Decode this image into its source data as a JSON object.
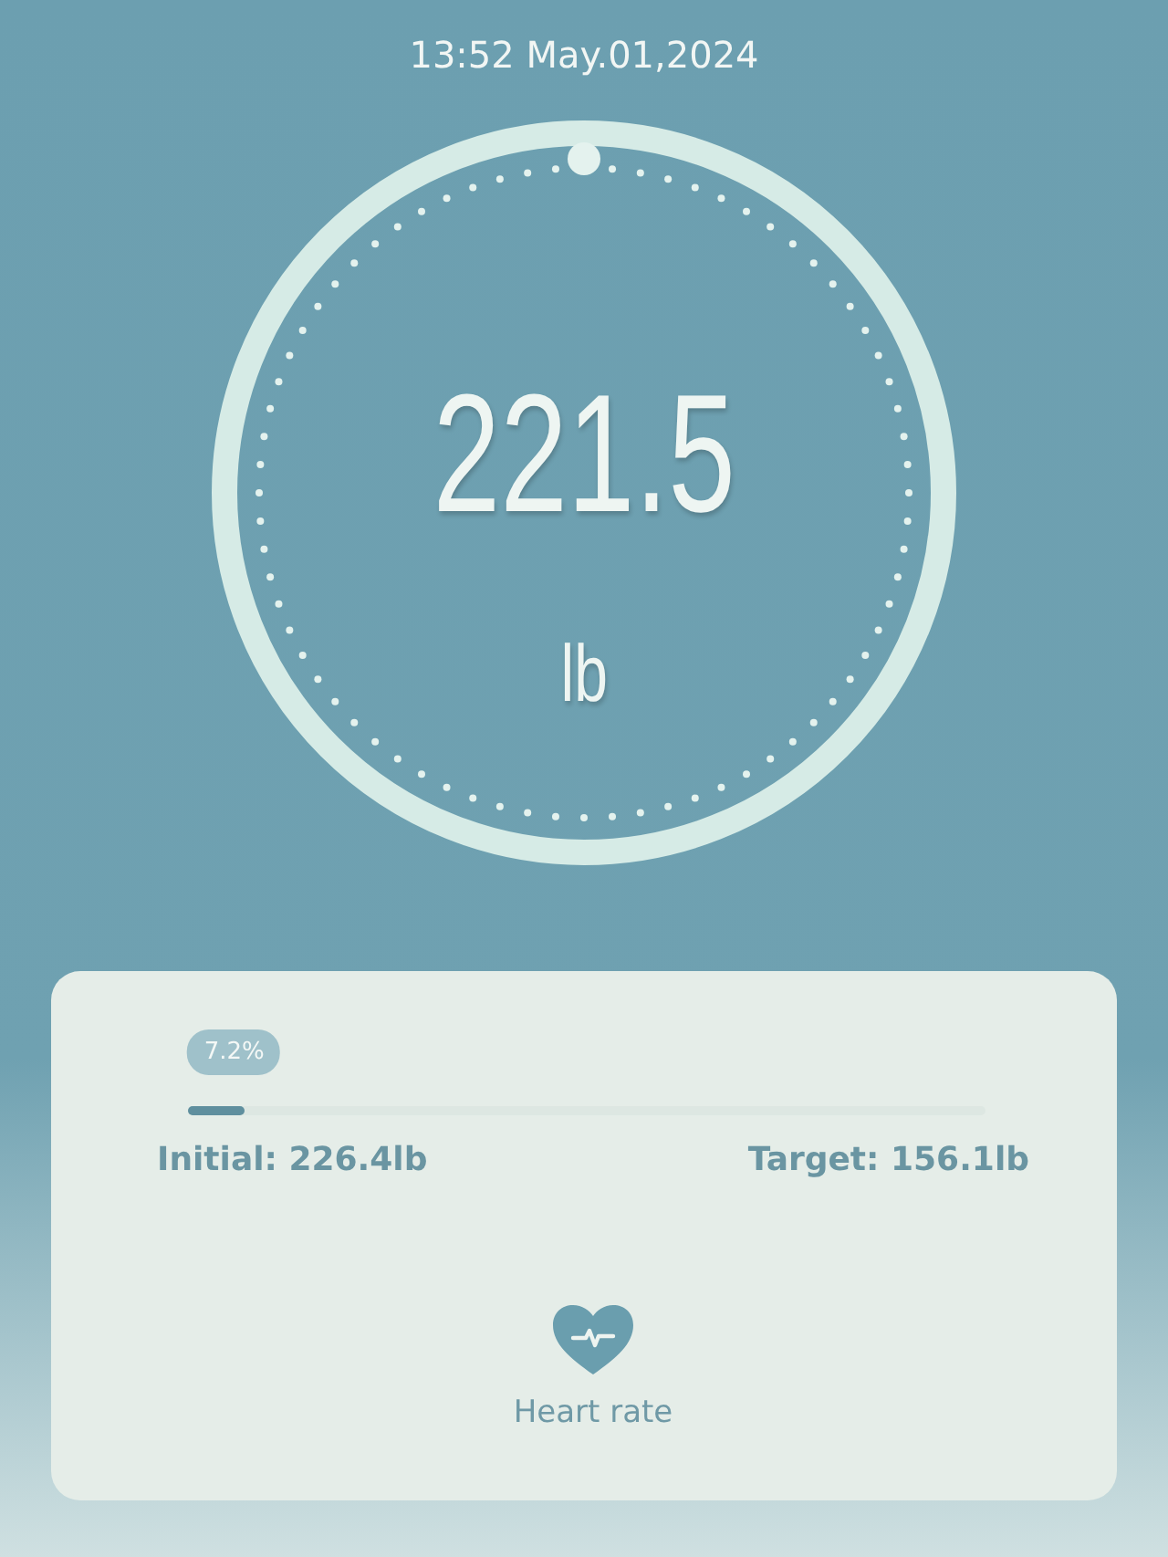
{
  "datetime": "13:52 May.01,2024",
  "weight": {
    "value": "221.5",
    "unit": "lb"
  },
  "progress": {
    "label": "7.2%",
    "level": 0.072,
    "initial": "Initial: 226.4lb",
    "target": "Target: 156.1lb"
  },
  "heart_rate": {
    "label": "Heart rate"
  }
}
